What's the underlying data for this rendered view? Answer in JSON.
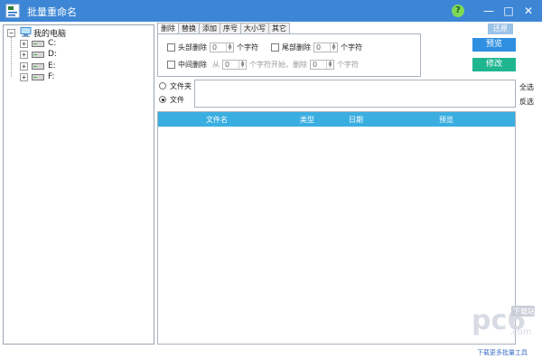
{
  "window": {
    "title": "批量重命名",
    "help_label": "?",
    "minimize_label": "—",
    "maximize_label": "□",
    "close_label": "✕",
    "accent_color": "#3d86d6"
  },
  "tree": {
    "root": "我的电脑",
    "root_expander": "−",
    "drives": [
      {
        "label": "C:",
        "expander": "+"
      },
      {
        "label": "D:",
        "expander": "+"
      },
      {
        "label": "E:",
        "expander": "+"
      },
      {
        "label": "F:",
        "expander": "+"
      }
    ]
  },
  "tabs": [
    "删除",
    "替换",
    "添加",
    "序号",
    "大小写",
    "其它"
  ],
  "delete_tab": {
    "row1": {
      "head_delete": "头部删除",
      "head_value": "0",
      "head_unit": "个字符",
      "tail_delete": "尾部删除",
      "tail_value": "0",
      "tail_unit": "个字符"
    },
    "row2": {
      "middle_delete": "中间删除",
      "from_label": "从",
      "from_value": "0",
      "start_text": "个字符开始，删除",
      "count_value": "0",
      "count_unit": "个字符"
    }
  },
  "actions": {
    "disabled_label": "还原",
    "preview_label": "预览",
    "modify_label": "修改",
    "preview_color": "#2f8fe0",
    "modify_color": "#1fb58f"
  },
  "mode": {
    "folder_label": "文件夹",
    "file_label": "文件",
    "selected": "file"
  },
  "selection": {
    "select_all": "全选",
    "invert": "反选"
  },
  "table": {
    "columns": [
      "文件名",
      "类型",
      "日期",
      "预览"
    ],
    "header_color": "#3aaee0"
  },
  "watermark": {
    "logo": "pc6",
    "badge": "下载站",
    "domain": ".com",
    "caption": "下载更多批量工具"
  }
}
